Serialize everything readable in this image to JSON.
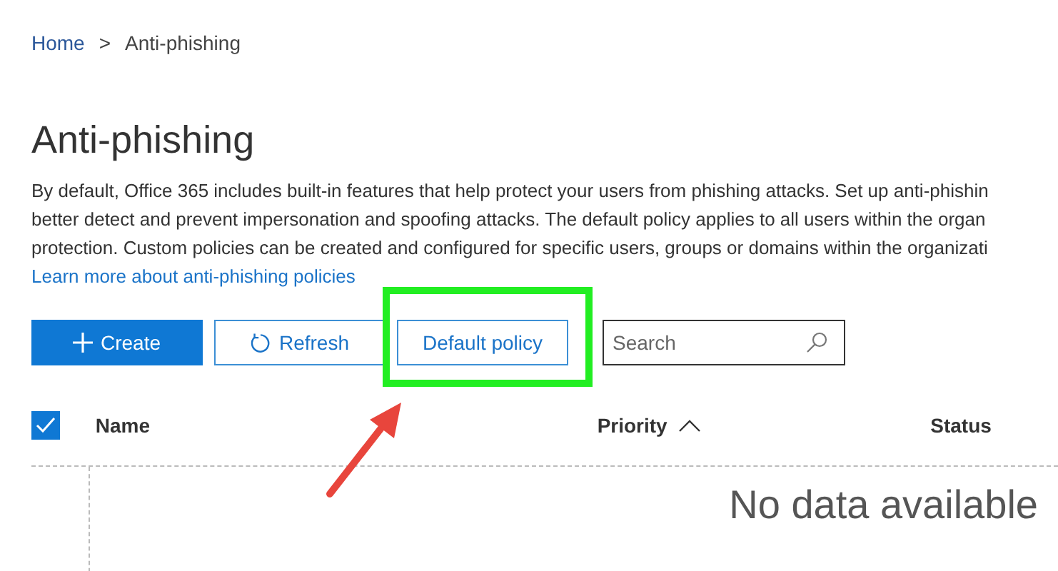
{
  "breadcrumb": [
    {
      "label": "Home"
    },
    {
      "label": ">"
    },
    {
      "label": "Anti-phishing"
    }
  ],
  "title": "Anti-phishing",
  "description": [
    "By default, Office 365 includes built-in features that help protect your users from phishing attacks. Set up anti-phishin",
    "better detect and prevent impersonation and spoofing attacks. The default policy applies to all users within the organ",
    "protection. Custom policies can be created and configured for specific users, groups or domains within the organizati"
  ],
  "learn_more_link": "Learn more about anti-phishing policies",
  "toolbar": [
    {
      "kind": "create",
      "label": "Create"
    },
    {
      "kind": "refresh",
      "label": "Refresh"
    },
    {
      "kind": "plain",
      "label": "Default policy"
    }
  ],
  "search": {
    "placeholder": "Search"
  },
  "table": {
    "select_all_checked": true,
    "columns": [
      {
        "label": "Name",
        "sorted": false
      },
      {
        "label": "Priority",
        "sorted": true
      },
      {
        "label": "Status",
        "sorted": false
      }
    ],
    "empty_message": "No data available"
  }
}
